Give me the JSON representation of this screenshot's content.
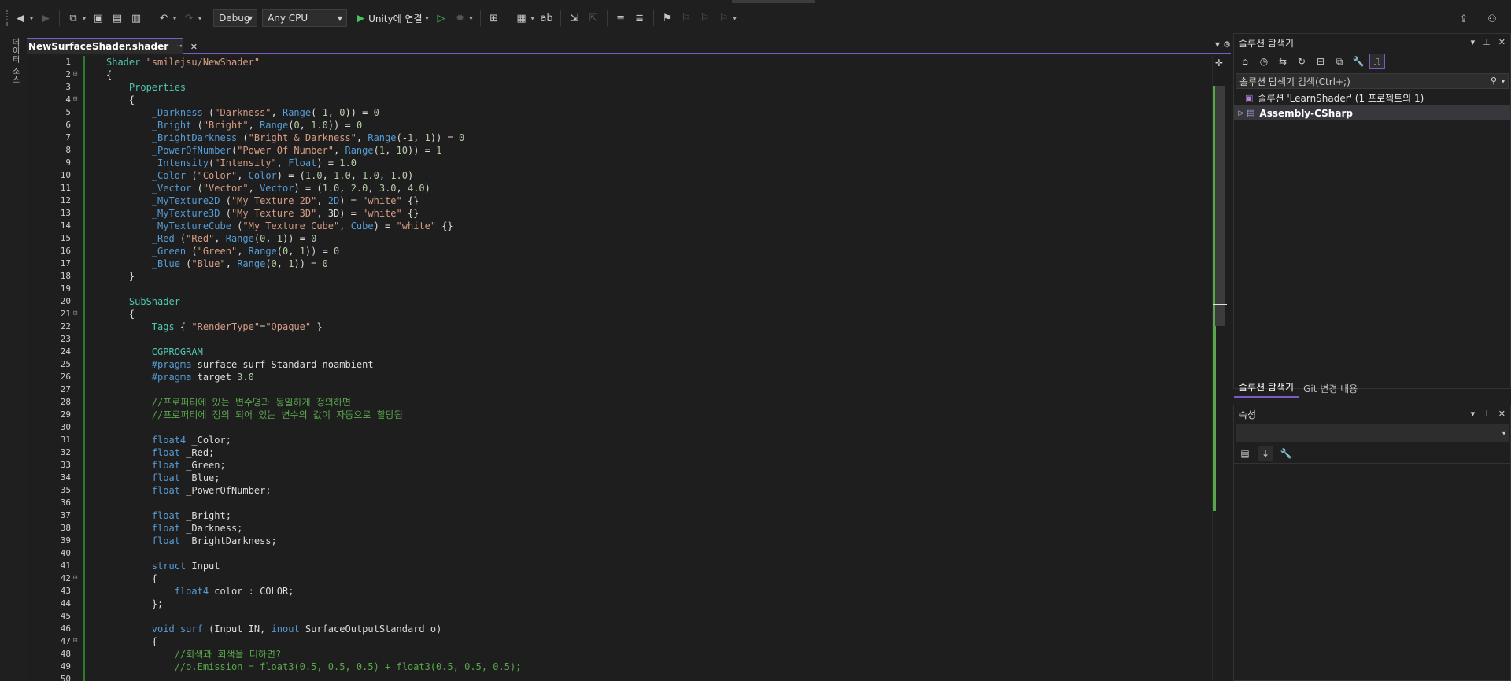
{
  "toolbar": {
    "config": "Debug",
    "platform": "Any CPU",
    "run_label": "Unity에 연결"
  },
  "left_strip": {
    "tab_label": "데이터 소스"
  },
  "document": {
    "tab_name": "NewSurfaceShader.shader",
    "pin_glyph": "⊸",
    "close_glyph": "✕"
  },
  "editor": {
    "line_count": 50,
    "lines": [
      [
        [
          "sec",
          "Shader "
        ],
        [
          "str",
          "\"smilejsu/NewShader\""
        ]
      ],
      [
        [
          "id",
          "{"
        ]
      ],
      [
        [
          "id",
          "    "
        ],
        [
          "sec",
          "Properties"
        ]
      ],
      [
        [
          "id",
          "    {"
        ]
      ],
      [
        [
          "id",
          "        "
        ],
        [
          "prop",
          "_Darkness"
        ],
        [
          "id",
          " ("
        ],
        [
          "str",
          "\"Darkness\""
        ],
        [
          "id",
          ", "
        ],
        [
          "kw",
          "Range"
        ],
        [
          "id",
          "(-"
        ],
        [
          "num",
          "1"
        ],
        [
          "id",
          ", "
        ],
        [
          "num",
          "0"
        ],
        [
          "id",
          ")) = "
        ],
        [
          "num",
          "0"
        ]
      ],
      [
        [
          "id",
          "        "
        ],
        [
          "prop",
          "_Bright"
        ],
        [
          "id",
          " ("
        ],
        [
          "str",
          "\"Bright\""
        ],
        [
          "id",
          ", "
        ],
        [
          "kw",
          "Range"
        ],
        [
          "id",
          "("
        ],
        [
          "num",
          "0"
        ],
        [
          "id",
          ", "
        ],
        [
          "num",
          "1.0"
        ],
        [
          "id",
          ")) = "
        ],
        [
          "num",
          "0"
        ]
      ],
      [
        [
          "id",
          "        "
        ],
        [
          "prop",
          "_BrightDarkness"
        ],
        [
          "id",
          " ("
        ],
        [
          "str",
          "\"Bright & Darkness\""
        ],
        [
          "id",
          ", "
        ],
        [
          "kw",
          "Range"
        ],
        [
          "id",
          "(-"
        ],
        [
          "num",
          "1"
        ],
        [
          "id",
          ", "
        ],
        [
          "num",
          "1"
        ],
        [
          "id",
          ")) = "
        ],
        [
          "num",
          "0"
        ]
      ],
      [
        [
          "id",
          "        "
        ],
        [
          "prop",
          "_PowerOfNumber"
        ],
        [
          "id",
          "("
        ],
        [
          "str",
          "\"Power Of Number\""
        ],
        [
          "id",
          ", "
        ],
        [
          "kw",
          "Range"
        ],
        [
          "id",
          "("
        ],
        [
          "num",
          "1"
        ],
        [
          "id",
          ", "
        ],
        [
          "num",
          "10"
        ],
        [
          "id",
          ")) = "
        ],
        [
          "num",
          "1"
        ]
      ],
      [
        [
          "id",
          "        "
        ],
        [
          "prop",
          "_Intensity"
        ],
        [
          "id",
          "("
        ],
        [
          "str",
          "\"Intensity\""
        ],
        [
          "id",
          ", "
        ],
        [
          "kw",
          "Float"
        ],
        [
          "id",
          ") = "
        ],
        [
          "num",
          "1.0"
        ]
      ],
      [
        [
          "id",
          "        "
        ],
        [
          "prop",
          "_Color"
        ],
        [
          "id",
          " ("
        ],
        [
          "str",
          "\"Color\""
        ],
        [
          "id",
          ", "
        ],
        [
          "kw",
          "Color"
        ],
        [
          "id",
          ") = ("
        ],
        [
          "num",
          "1.0"
        ],
        [
          "id",
          ", "
        ],
        [
          "num",
          "1.0"
        ],
        [
          "id",
          ", "
        ],
        [
          "num",
          "1.0"
        ],
        [
          "id",
          ", "
        ],
        [
          "num",
          "1.0"
        ],
        [
          "id",
          ")"
        ]
      ],
      [
        [
          "id",
          "        "
        ],
        [
          "prop",
          "_Vector"
        ],
        [
          "id",
          " ("
        ],
        [
          "str",
          "\"Vector\""
        ],
        [
          "id",
          ", "
        ],
        [
          "kw",
          "Vector"
        ],
        [
          "id",
          ") = ("
        ],
        [
          "num",
          "1.0"
        ],
        [
          "id",
          ", "
        ],
        [
          "num",
          "2.0"
        ],
        [
          "id",
          ", "
        ],
        [
          "num",
          "3.0"
        ],
        [
          "id",
          ", "
        ],
        [
          "num",
          "4.0"
        ],
        [
          "id",
          ")"
        ]
      ],
      [
        [
          "id",
          "        "
        ],
        [
          "prop",
          "_MyTexture2D"
        ],
        [
          "id",
          " ("
        ],
        [
          "str",
          "\"My Texture 2D\""
        ],
        [
          "id",
          ", "
        ],
        [
          "kw",
          "2D"
        ],
        [
          "id",
          ") = "
        ],
        [
          "str",
          "\"white\""
        ],
        [
          "id",
          " {}"
        ]
      ],
      [
        [
          "id",
          "        "
        ],
        [
          "prop",
          "_MyTexture3D"
        ],
        [
          "id",
          " ("
        ],
        [
          "str",
          "\"My Texture 3D\""
        ],
        [
          "id",
          ", "
        ],
        [
          "id",
          "3D"
        ],
        [
          "id",
          ") = "
        ],
        [
          "str",
          "\"white\""
        ],
        [
          "id",
          " {}"
        ]
      ],
      [
        [
          "id",
          "        "
        ],
        [
          "prop",
          "_MyTextureCube"
        ],
        [
          "id",
          " ("
        ],
        [
          "str",
          "\"My Texture Cube\""
        ],
        [
          "id",
          ", "
        ],
        [
          "kw",
          "Cube"
        ],
        [
          "id",
          ") = "
        ],
        [
          "str",
          "\"white\""
        ],
        [
          "id",
          " {}"
        ]
      ],
      [
        [
          "id",
          "        "
        ],
        [
          "prop",
          "_Red"
        ],
        [
          "id",
          " ("
        ],
        [
          "str",
          "\"Red\""
        ],
        [
          "id",
          ", "
        ],
        [
          "kw",
          "Range"
        ],
        [
          "id",
          "("
        ],
        [
          "num",
          "0"
        ],
        [
          "id",
          ", "
        ],
        [
          "num",
          "1"
        ],
        [
          "id",
          ")) = "
        ],
        [
          "num",
          "0"
        ]
      ],
      [
        [
          "id",
          "        "
        ],
        [
          "prop",
          "_Green"
        ],
        [
          "id",
          " ("
        ],
        [
          "str",
          "\"Green\""
        ],
        [
          "id",
          ", "
        ],
        [
          "kw",
          "Range"
        ],
        [
          "id",
          "("
        ],
        [
          "num",
          "0"
        ],
        [
          "id",
          ", "
        ],
        [
          "num",
          "1"
        ],
        [
          "id",
          ")) = "
        ],
        [
          "num",
          "0"
        ]
      ],
      [
        [
          "id",
          "        "
        ],
        [
          "prop",
          "_Blue"
        ],
        [
          "id",
          " ("
        ],
        [
          "str",
          "\"Blue\""
        ],
        [
          "id",
          ", "
        ],
        [
          "kw",
          "Range"
        ],
        [
          "id",
          "("
        ],
        [
          "num",
          "0"
        ],
        [
          "id",
          ", "
        ],
        [
          "num",
          "1"
        ],
        [
          "id",
          ")) = "
        ],
        [
          "num",
          "0"
        ]
      ],
      [
        [
          "id",
          "    }"
        ]
      ],
      [
        [
          "id",
          ""
        ]
      ],
      [
        [
          "id",
          "    "
        ],
        [
          "sec",
          "SubShader"
        ]
      ],
      [
        [
          "id",
          "    {"
        ]
      ],
      [
        [
          "id",
          "        "
        ],
        [
          "sec",
          "Tags"
        ],
        [
          "id",
          " { "
        ],
        [
          "str",
          "\"RenderType\""
        ],
        [
          "id",
          "="
        ],
        [
          "str",
          "\"Opaque\""
        ],
        [
          "id",
          " }"
        ]
      ],
      [
        [
          "id",
          ""
        ]
      ],
      [
        [
          "id",
          "        "
        ],
        [
          "sec",
          "CGPROGRAM"
        ]
      ],
      [
        [
          "id",
          "        "
        ],
        [
          "pre",
          "#pragma"
        ],
        [
          "id",
          " surface surf Standard noambient"
        ]
      ],
      [
        [
          "id",
          "        "
        ],
        [
          "pre",
          "#pragma"
        ],
        [
          "id",
          " target "
        ],
        [
          "num",
          "3.0"
        ]
      ],
      [
        [
          "id",
          ""
        ]
      ],
      [
        [
          "id",
          "        "
        ],
        [
          "cm",
          "//프로퍼티에 있는 변수명과 동일하게 정의하면"
        ]
      ],
      [
        [
          "id",
          "        "
        ],
        [
          "cm",
          "//프로퍼티에 정의 되어 있는 변수의 값이 자동으로 할당됨"
        ]
      ],
      [
        [
          "id",
          ""
        ]
      ],
      [
        [
          "id",
          "        "
        ],
        [
          "kw",
          "float4"
        ],
        [
          "id",
          " _Color;"
        ]
      ],
      [
        [
          "id",
          "        "
        ],
        [
          "kw",
          "float"
        ],
        [
          "id",
          " _Red;"
        ]
      ],
      [
        [
          "id",
          "        "
        ],
        [
          "kw",
          "float"
        ],
        [
          "id",
          " _Green;"
        ]
      ],
      [
        [
          "id",
          "        "
        ],
        [
          "kw",
          "float"
        ],
        [
          "id",
          " _Blue;"
        ]
      ],
      [
        [
          "id",
          "        "
        ],
        [
          "kw",
          "float"
        ],
        [
          "id",
          " _PowerOfNumber;"
        ]
      ],
      [
        [
          "id",
          ""
        ]
      ],
      [
        [
          "id",
          "        "
        ],
        [
          "kw",
          "float"
        ],
        [
          "id",
          " _Bright;"
        ]
      ],
      [
        [
          "id",
          "        "
        ],
        [
          "kw",
          "float"
        ],
        [
          "id",
          " _Darkness;"
        ]
      ],
      [
        [
          "id",
          "        "
        ],
        [
          "kw",
          "float"
        ],
        [
          "id",
          " _BrightDarkness;"
        ]
      ],
      [
        [
          "id",
          ""
        ]
      ],
      [
        [
          "id",
          "        "
        ],
        [
          "kw",
          "struct"
        ],
        [
          "id",
          " Input"
        ]
      ],
      [
        [
          "id",
          "        {"
        ]
      ],
      [
        [
          "id",
          "            "
        ],
        [
          "kw",
          "float4"
        ],
        [
          "id",
          " color : COLOR;"
        ]
      ],
      [
        [
          "id",
          "        };"
        ]
      ],
      [
        [
          "id",
          ""
        ]
      ],
      [
        [
          "id",
          "        "
        ],
        [
          "kw",
          "void"
        ],
        [
          "id",
          " "
        ],
        [
          "kw",
          "surf"
        ],
        [
          "id",
          " (Input IN, "
        ],
        [
          "kw",
          "inout"
        ],
        [
          "id",
          " SurfaceOutputStandard o)"
        ]
      ],
      [
        [
          "id",
          "        {"
        ]
      ],
      [
        [
          "id",
          "            "
        ],
        [
          "cm",
          "//회색과 회색을 더하면?"
        ]
      ],
      [
        [
          "id",
          "            "
        ],
        [
          "cm",
          "//o.Emission = float3(0.5, 0.5, 0.5) + float3(0.5, 0.5, 0.5);"
        ]
      ],
      [
        [
          "id",
          ""
        ]
      ]
    ]
  },
  "solution_explorer": {
    "title": "솔루션 탐색기",
    "search_placeholder": "솔루션 탐색기 검색(Ctrl+;)",
    "solution_row": "솔루션 'LearnShader' (1 프로젝트의 1)",
    "project_row": "Assembly-CSharp",
    "tab_active": "솔루션 탐색기",
    "tab_other": "Git 변경 내용"
  },
  "properties": {
    "title": "속성"
  },
  "colors": {
    "accent": "#7a5cc9",
    "change_green": "#57a64a",
    "run_green": "#3fc65a"
  }
}
